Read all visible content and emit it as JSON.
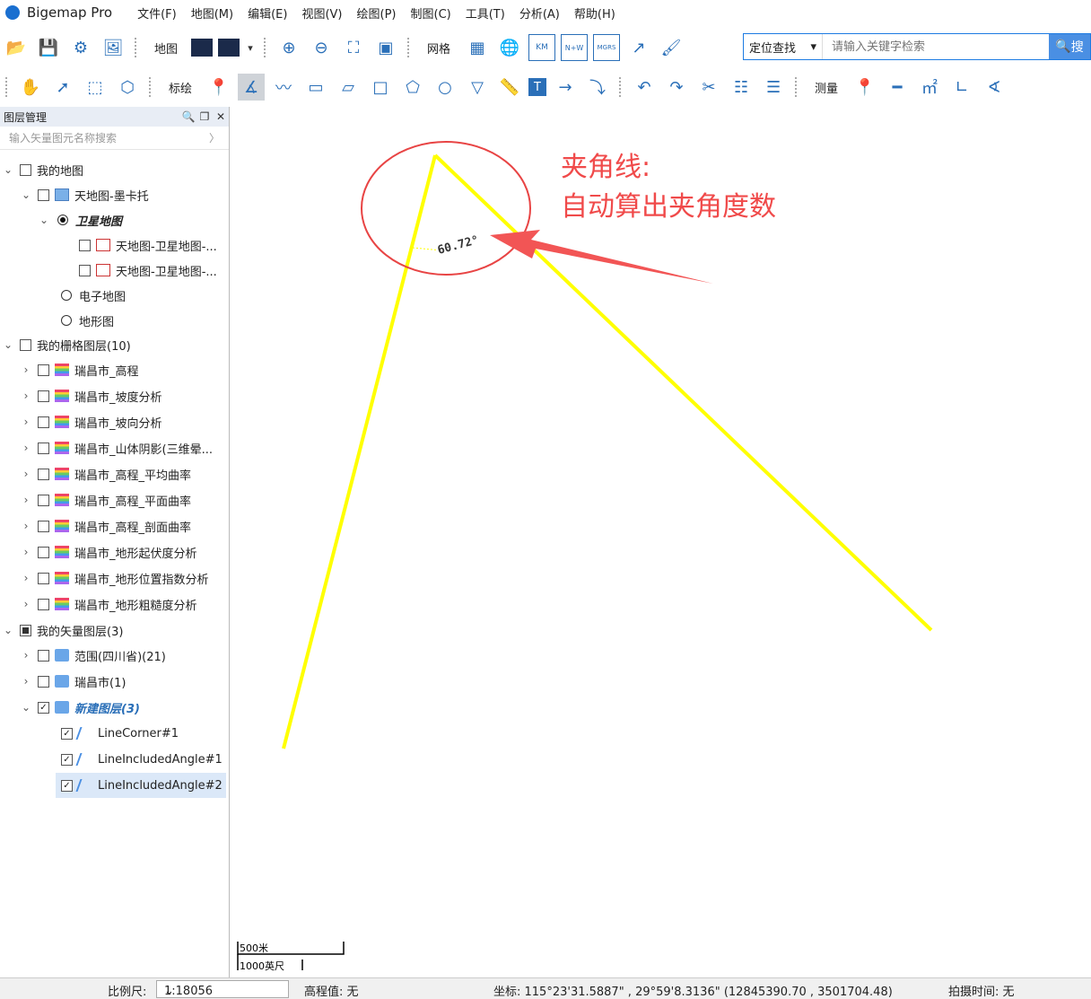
{
  "app": {
    "title": "Bigemap Pro"
  },
  "menu": [
    "文件(F)",
    "地图(M)",
    "编辑(E)",
    "视图(V)",
    "绘图(P)",
    "制图(C)",
    "工具(T)",
    "分析(A)",
    "帮助(H)"
  ],
  "toolbar1": {
    "map_label": "地图",
    "grid_label": "网格",
    "search_mode": "定位查找",
    "search_placeholder": "请输入关键字检索",
    "search_button": "搜"
  },
  "toolbar2": {
    "draw_label": "标绘",
    "measure_label": "测量"
  },
  "panel": {
    "title": "图层管理",
    "search_placeholder": "输入矢量图元名称搜索",
    "nodes": [
      "我的地图",
      "天地图-墨卡托",
      "卫星地图",
      "天地图-卫星地图-...",
      "天地图-卫星地图-...",
      "电子地图",
      "地形图",
      "我的栅格图层(10)",
      "瑞昌市_高程",
      "瑞昌市_坡度分析",
      "瑞昌市_坡向分析",
      "瑞昌市_山体阴影(三维晕...",
      "瑞昌市_高程_平均曲率",
      "瑞昌市_高程_平面曲率",
      "瑞昌市_高程_剖面曲率",
      "瑞昌市_地形起伏度分析",
      "瑞昌市_地形位置指数分析",
      "瑞昌市_地形粗糙度分析",
      "我的矢量图层(3)",
      "范围(四川省)(21)",
      "瑞昌市(1)",
      "新建图层(3)",
      "LineCorner#1",
      "LineIncludedAngle#1",
      "LineIncludedAngle#2"
    ]
  },
  "map": {
    "angle_label": "60.72°",
    "annotation_line1": "夹角线:",
    "annotation_line2": "自动算出夹角度数",
    "scale_m": "500米",
    "scale_ft": "1000英尺",
    "line_color": "#ffff00",
    "annotation_color": "#f04a4a"
  },
  "status": {
    "scale_label": "比例尺:",
    "scale_value": "1:18056",
    "elevation": "高程值: 无",
    "coords": "坐标: 115°23'31.5887\" , 29°59'8.3136\"  (12845390.70 , 3501704.48)",
    "capture_time": "拍摄时间: 无"
  }
}
